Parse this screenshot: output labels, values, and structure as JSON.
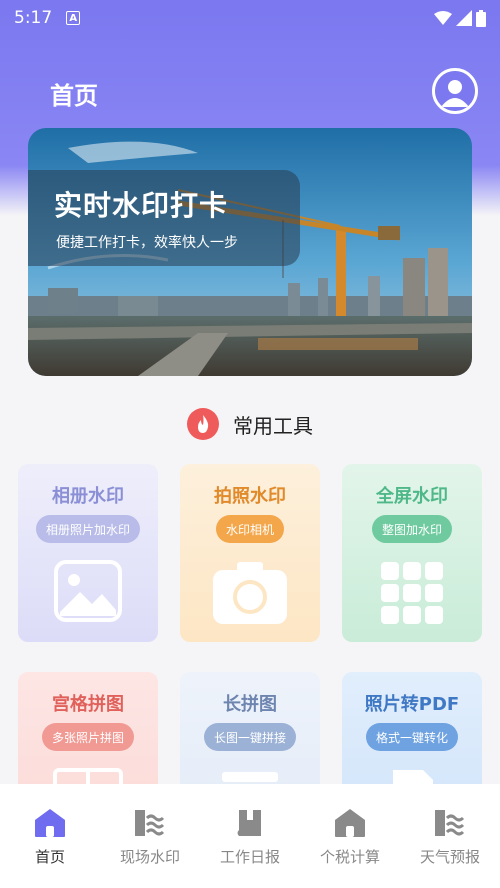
{
  "status_bar": {
    "time": "5:17",
    "notification_icon": "a-icon"
  },
  "header": {
    "title": "首页"
  },
  "banner": {
    "title": "实时水印打卡",
    "subtitle": "便捷工作打卡，效率快人一步"
  },
  "tools_section": {
    "title": "常用工具"
  },
  "cards": [
    {
      "title": "相册水印",
      "pill": "相册照片加水印",
      "icon": "image-icon"
    },
    {
      "title": "拍照水印",
      "pill": "水印相机",
      "icon": "camera-icon"
    },
    {
      "title": "全屏水印",
      "pill": "整图加水印",
      "icon": "grid-icon"
    },
    {
      "title": "宫格拼图",
      "pill": "多张照片拼图",
      "icon": "collage-icon"
    },
    {
      "title": "长拼图",
      "pill": "长图一键拼接",
      "icon": "long-image-icon"
    },
    {
      "title": "照片转PDF",
      "pill": "格式一键转化",
      "icon": "pdf-icon"
    }
  ],
  "bottom_nav": [
    {
      "label": "首页",
      "icon": "home-icon",
      "active": true
    },
    {
      "label": "现场水印",
      "icon": "scene-icon",
      "active": false
    },
    {
      "label": "工作日报",
      "icon": "book-icon",
      "active": false
    },
    {
      "label": "个税计算",
      "icon": "house-icon",
      "active": false
    },
    {
      "label": "天气预报",
      "icon": "weather-icon",
      "active": false
    }
  ],
  "colors": {
    "accent": "#6f6cf0",
    "header_bg": "#7b78f0",
    "fire": "#ef5b5b"
  }
}
